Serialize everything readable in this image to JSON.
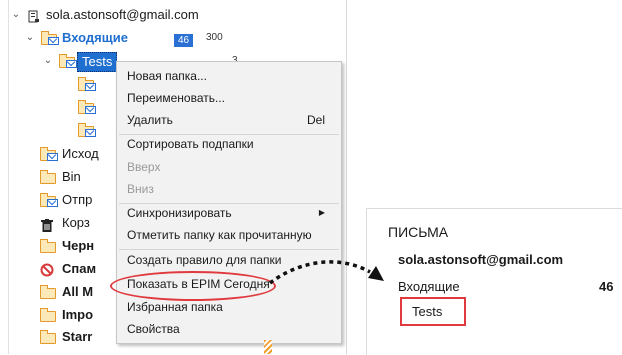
{
  "tree": {
    "account": "sola.astonsoft@gmail.com",
    "inbox": {
      "label": "Входящие",
      "unread": "46",
      "total": "300"
    },
    "tests": {
      "label": "Tests",
      "count": "3"
    },
    "folders": [
      "Исход",
      "Bin",
      "Отпр",
      "Корз",
      "Черн",
      "Спам",
      "All M",
      "Impo",
      "Starr"
    ]
  },
  "context_menu": {
    "items": [
      {
        "label": "Новая папка...",
        "shortcut": ""
      },
      {
        "label": "Переименовать...",
        "shortcut": ""
      },
      {
        "label": "Удалить",
        "shortcut": "Del"
      },
      {
        "label": "Сортировать подпапки",
        "shortcut": ""
      },
      {
        "label": "Вверх",
        "shortcut": ""
      },
      {
        "label": "Вниз",
        "shortcut": ""
      },
      {
        "label": "Синхронизировать",
        "shortcut": ""
      },
      {
        "label": "Отметить папку как прочитанную",
        "shortcut": ""
      },
      {
        "label": "Создать правило для папки",
        "shortcut": ""
      },
      {
        "label": "Показать в EPIM Сегодня",
        "shortcut": ""
      },
      {
        "label": "Избранная папка",
        "shortcut": ""
      },
      {
        "label": "Свойства",
        "shortcut": ""
      }
    ]
  },
  "panel": {
    "heading": "ПИСЬМА",
    "account": "sola.astonsoft@gmail.com",
    "inbox_label": "Входящие",
    "inbox_count": "46",
    "tests_label": "Tests"
  },
  "colors": {
    "inbox_blue": "#1f6fd1",
    "badge_bg": "#2a6fd3",
    "highlight_red": "#e0393e",
    "selection": "#cce4f7"
  }
}
